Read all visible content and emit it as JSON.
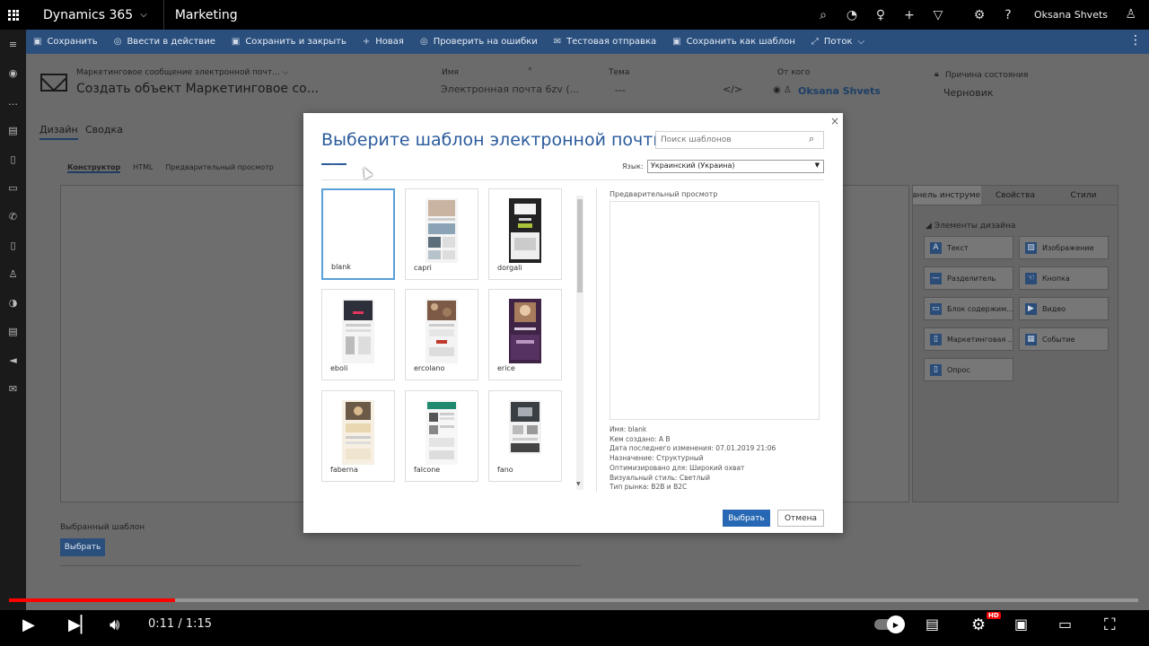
{
  "topbar": {
    "app_name": "Dynamics 365",
    "module_name": "Marketing",
    "user_name": "Oksana Shvets",
    "icons": [
      "search-icon",
      "task-icon",
      "lightbulb-icon",
      "plus-icon",
      "filter-icon",
      "gear-icon",
      "help-icon"
    ]
  },
  "commandbar": {
    "items": [
      {
        "label": "Сохранить",
        "icon": "save-icon"
      },
      {
        "label": "Ввести в действие",
        "icon": "check-circle-icon"
      },
      {
        "label": "Сохранить и закрыть",
        "icon": "save-close-icon"
      },
      {
        "label": "Новая",
        "icon": "plus-icon"
      },
      {
        "label": "Проверить на ошибки",
        "icon": "check-errors-icon"
      },
      {
        "label": "Тестовая отправка",
        "icon": "envelope-icon"
      },
      {
        "label": "Сохранить как шаблон",
        "icon": "template-icon"
      },
      {
        "label": "Поток",
        "icon": "flow-icon"
      }
    ]
  },
  "header": {
    "entity_type": "Маркетинговое сообщение электронной почт...",
    "title": "Создать объект Маркетинговое со...",
    "name_label": "Имя",
    "name_value": "Электронная почта 6zv (...",
    "subject_label": "Тема",
    "subject_value": "---",
    "from_label": "От кого",
    "from_value": "Oksana Shvets",
    "status_label": "Причина состояния",
    "status_value": "Черновик"
  },
  "tabs": {
    "design": "Дизайн",
    "summary": "Сводка"
  },
  "subtabs": {
    "designer": "Конструктор",
    "html": "HTML",
    "preview": "Предварительный просмотр"
  },
  "right_panel": {
    "tabs": [
      "Панель инструме...",
      "Свойства",
      "Стили"
    ],
    "section": "Элементы дизайна",
    "tools": [
      "Текст",
      "Изображение",
      "Разделитель",
      "Кнопка",
      "Блок содержим...",
      "Видео",
      "Маркетинговая ...",
      "Событие",
      "Опрос"
    ]
  },
  "selected_template": {
    "label": "Выбранный шаблон",
    "button": "Выбрать"
  },
  "modal": {
    "title": "Выберите шаблон электронной почты",
    "search_placeholder": "Поиск шаблонов",
    "tab_dots": "....",
    "language_label": "Язык:",
    "language_value": "Украинский (Украина)",
    "preview_label": "Предварительный просмотр",
    "templates": [
      "blank",
      "capri",
      "dorgali",
      "eboli",
      "ercolano",
      "erice",
      "faberna",
      "falcone",
      "fano"
    ],
    "selected_template": "blank",
    "meta": [
      "Имя: blank",
      "Кем создано: A B",
      "Дата последнего изменения: 07.01.2019 21:06",
      "Назначение: Структурный",
      "Оптимизировано для: Широкий охват",
      "Визуальный стиль: Светлый",
      "Тип рынка: B2B и B2C"
    ],
    "select_button": "Выбрать",
    "cancel_button": "Отмена"
  },
  "video": {
    "time": "0:11 / 1:15",
    "progress": 0.147,
    "hd_badge": "HD"
  }
}
